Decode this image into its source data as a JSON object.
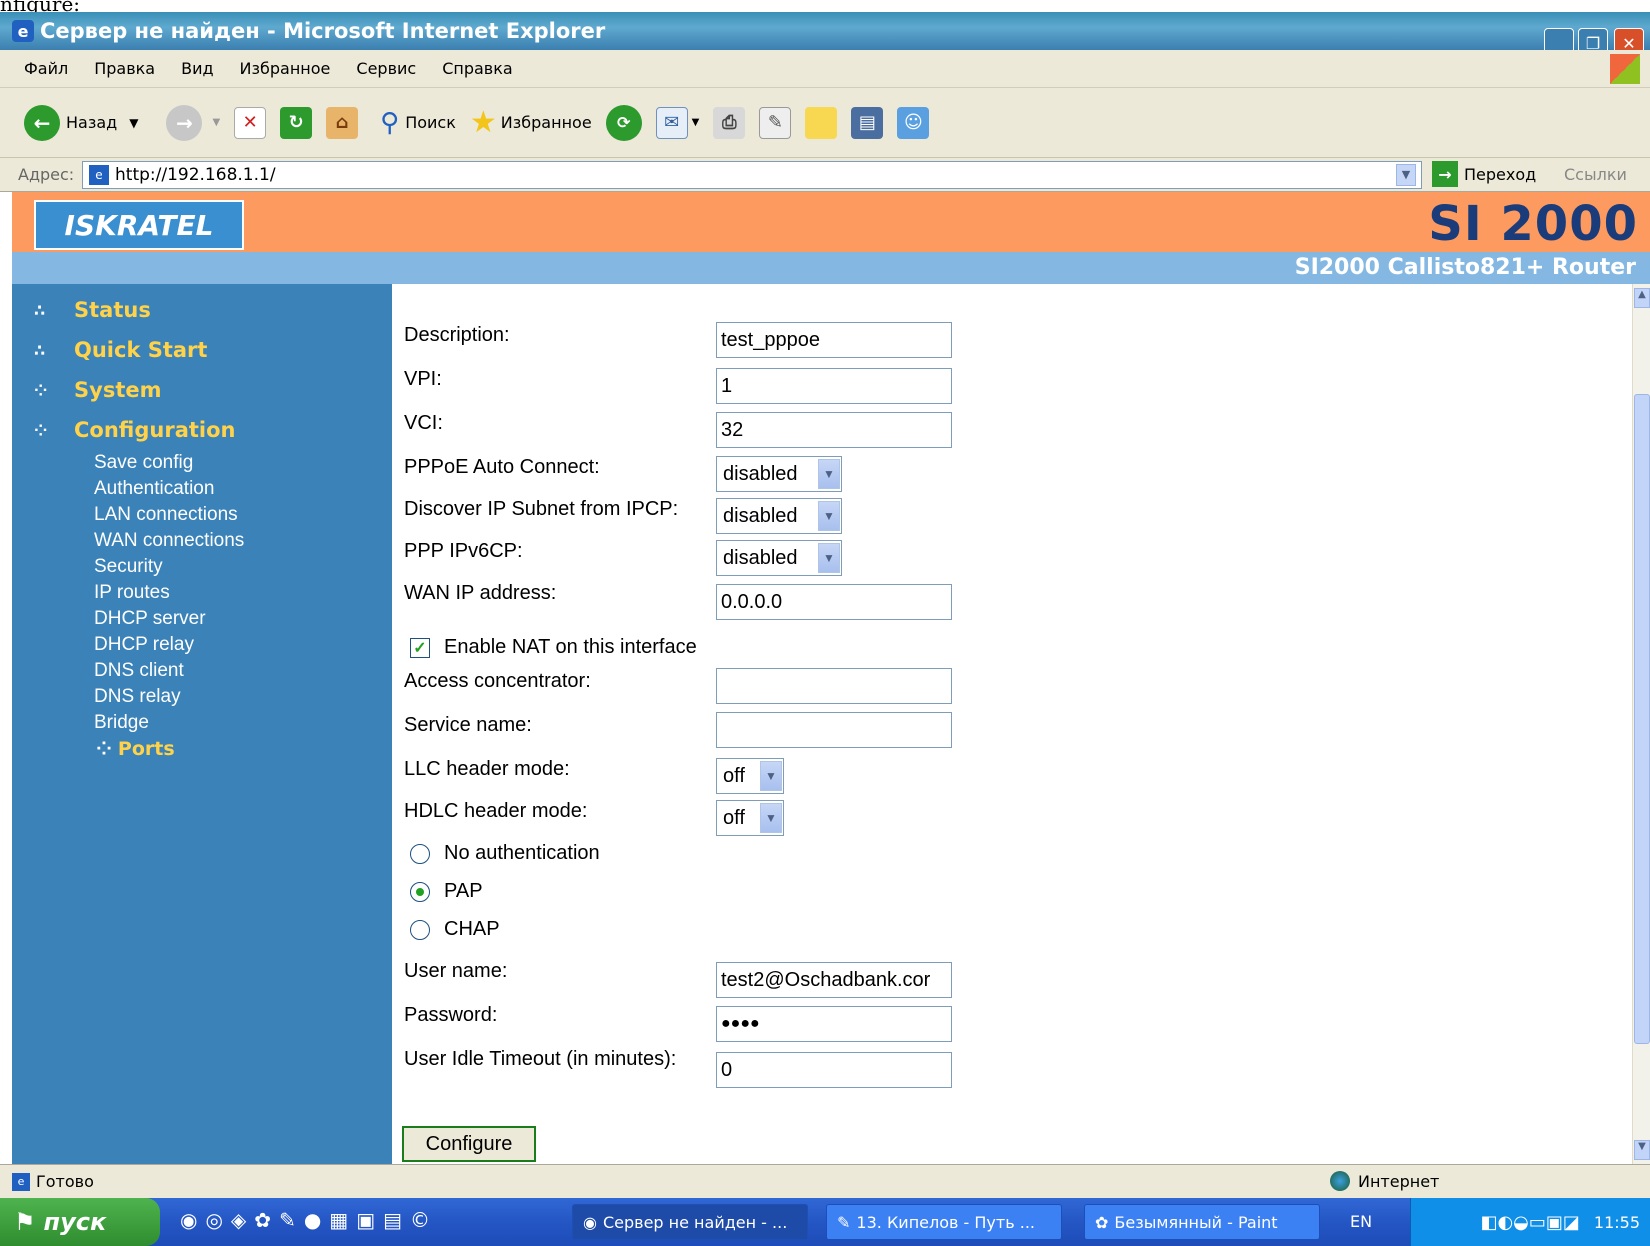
{
  "top_cut_text": "nfigure:",
  "window": {
    "title": "Сервер не найден - Microsoft Internet Explorer"
  },
  "menu": [
    "Файл",
    "Правка",
    "Вид",
    "Избранное",
    "Сервис",
    "Справка"
  ],
  "toolbar": {
    "back": "Назад",
    "search": "Поиск",
    "favorites": "Избранное"
  },
  "address": {
    "label": "Адрес:",
    "url": "http://192.168.1.1/",
    "go": "Переход",
    "links": "Ссылки"
  },
  "banner": {
    "logo": "ISKRATEL",
    "brand": "SI 2000",
    "subtitle": "SI2000 Callisto821+ Router"
  },
  "nav": {
    "items": [
      "Status",
      "Quick Start",
      "System",
      "Configuration"
    ],
    "sub": [
      "Save config",
      "Authentication",
      "LAN connections",
      "WAN connections",
      "Security",
      "IP routes",
      "DHCP server",
      "DHCP relay",
      "DNS client",
      "DNS relay",
      "Bridge"
    ],
    "current": "Ports"
  },
  "form": {
    "description": {
      "label": "Description:",
      "value": "test_pppoe"
    },
    "vpi": {
      "label": "VPI:",
      "value": "1"
    },
    "vci": {
      "label": "VCI:",
      "value": "32"
    },
    "auto_connect": {
      "label": "PPPoE Auto Connect:",
      "value": "disabled"
    },
    "discover": {
      "label": "Discover IP Subnet from IPCP:",
      "value": "disabled"
    },
    "ipv6cp": {
      "label": "PPP IPv6CP:",
      "value": "disabled"
    },
    "wan_ip": {
      "label": "WAN IP address:",
      "value": "0.0.0.0"
    },
    "nat": {
      "label": "Enable NAT on this interface",
      "checked": true
    },
    "access_concentrator": {
      "label": "Access concentrator:",
      "value": ""
    },
    "service_name": {
      "label": "Service name:",
      "value": ""
    },
    "llc": {
      "label": "LLC header mode:",
      "value": "off"
    },
    "hdlc": {
      "label": "HDLC header mode:",
      "value": "off"
    },
    "auth": {
      "options": [
        "No authentication",
        "PAP",
        "CHAP"
      ],
      "selected": "PAP"
    },
    "username": {
      "label": "User name:",
      "value": "test2@Oschadbank.cor"
    },
    "password": {
      "label": "Password:",
      "value": "●●●●"
    },
    "idle": {
      "label": "User Idle Timeout (in minutes):",
      "value": "0"
    },
    "submit": "Configure"
  },
  "status": {
    "left": "Готово",
    "zone": "Интернет"
  },
  "taskbar": {
    "start": "пуск",
    "tasks": [
      "Сервер не найден - ...",
      "13. Кипелов - Путь ...",
      "Безымянный - Paint"
    ],
    "lang": "EN",
    "clock": "11:55"
  }
}
